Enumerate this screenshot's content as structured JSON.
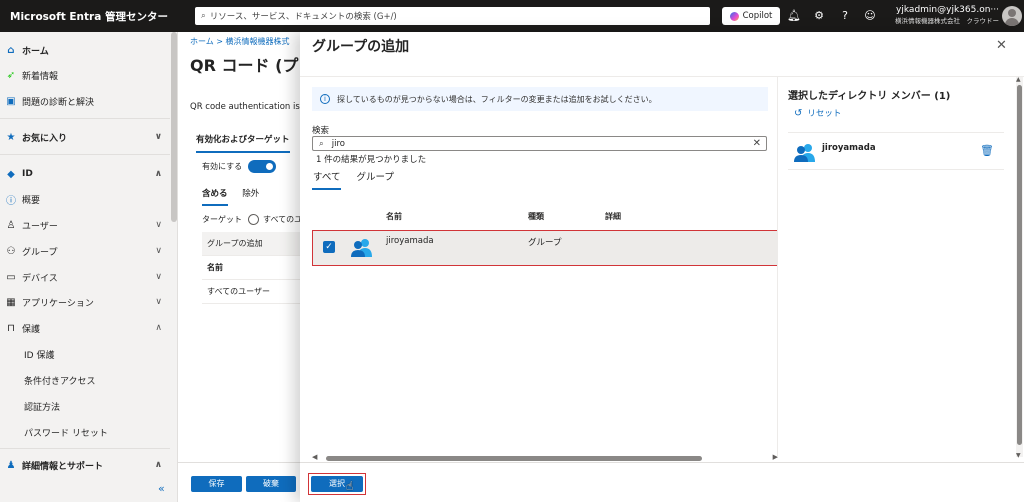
{
  "topbar": {
    "brand": "Microsoft Entra 管理センター",
    "search_placeholder": "リソース、サービス、ドキュメントの検索 (G+/)",
    "copilot_label": "Copilot",
    "account_email": "yjkadmin@yjk365.on···",
    "account_org": "横浜情報機器株式会社　クラウドー···"
  },
  "sidebar": {
    "items": [
      {
        "label": "ホーム",
        "icon": "home-icon"
      },
      {
        "label": "新着情報",
        "icon": "rocket-icon"
      },
      {
        "label": "問題の診断と解決",
        "icon": "diagnose-icon"
      },
      {
        "label": "お気に入り",
        "icon": "star-icon"
      },
      {
        "label": "ID",
        "icon": "identity-icon"
      },
      {
        "label": "概要",
        "icon": "info-icon"
      },
      {
        "label": "ユーザー",
        "icon": "user-icon"
      },
      {
        "label": "グループ",
        "icon": "group-icon"
      },
      {
        "label": "デバイス",
        "icon": "device-icon"
      },
      {
        "label": "アプリケーション",
        "icon": "apps-icon"
      },
      {
        "label": "保護",
        "icon": "lock-icon"
      },
      {
        "label": "ID 保護",
        "icon": ""
      },
      {
        "label": "条件付きアクセス",
        "icon": ""
      },
      {
        "label": "認証方法",
        "icon": ""
      },
      {
        "label": "パスワード リセット",
        "icon": ""
      },
      {
        "label": "詳細情報とサポート",
        "icon": "support-icon"
      }
    ]
  },
  "bgpage": {
    "breadcrumb": "ホーム > 横浜情報機器株式",
    "title": "QR コード (プレビ",
    "description": "QR code authentication is",
    "tab_active": "有効化およびターゲット",
    "tab_other": "構",
    "enable_label": "有効にする",
    "include_tab": "含める",
    "exclude_tab": "除外",
    "target_label": "ターゲット",
    "target_option": "すべてのユーザ",
    "table": {
      "add_group": "グループの追加",
      "name_header": "名前",
      "row1": "すべてのユーザー"
    },
    "save_label": "保存",
    "discard_label": "破棄"
  },
  "panel": {
    "title": "グループの追加",
    "info_text": "探しているものが見つからない場合は、フィルターの変更または追加をお試しください。",
    "search_label": "検索",
    "search_value": "jiro",
    "result_count": "1 件の結果が見つかりました",
    "filter_tabs": [
      "すべて",
      "グループ"
    ],
    "columns": [
      "名前",
      "種類",
      "詳細"
    ],
    "rows": [
      {
        "name": "jiroyamada",
        "type": "グループ",
        "details": "",
        "selected": true
      }
    ],
    "selected_title": "選択したディレクトリ メンバー (1)",
    "reset_label": "リセット",
    "selected_items": [
      "jiroyamada"
    ],
    "select_button": "選択"
  },
  "colors": {
    "accent": "#0f6cbd",
    "highlight_border": "#d13438",
    "topbar_bg": "#1b1a19"
  }
}
